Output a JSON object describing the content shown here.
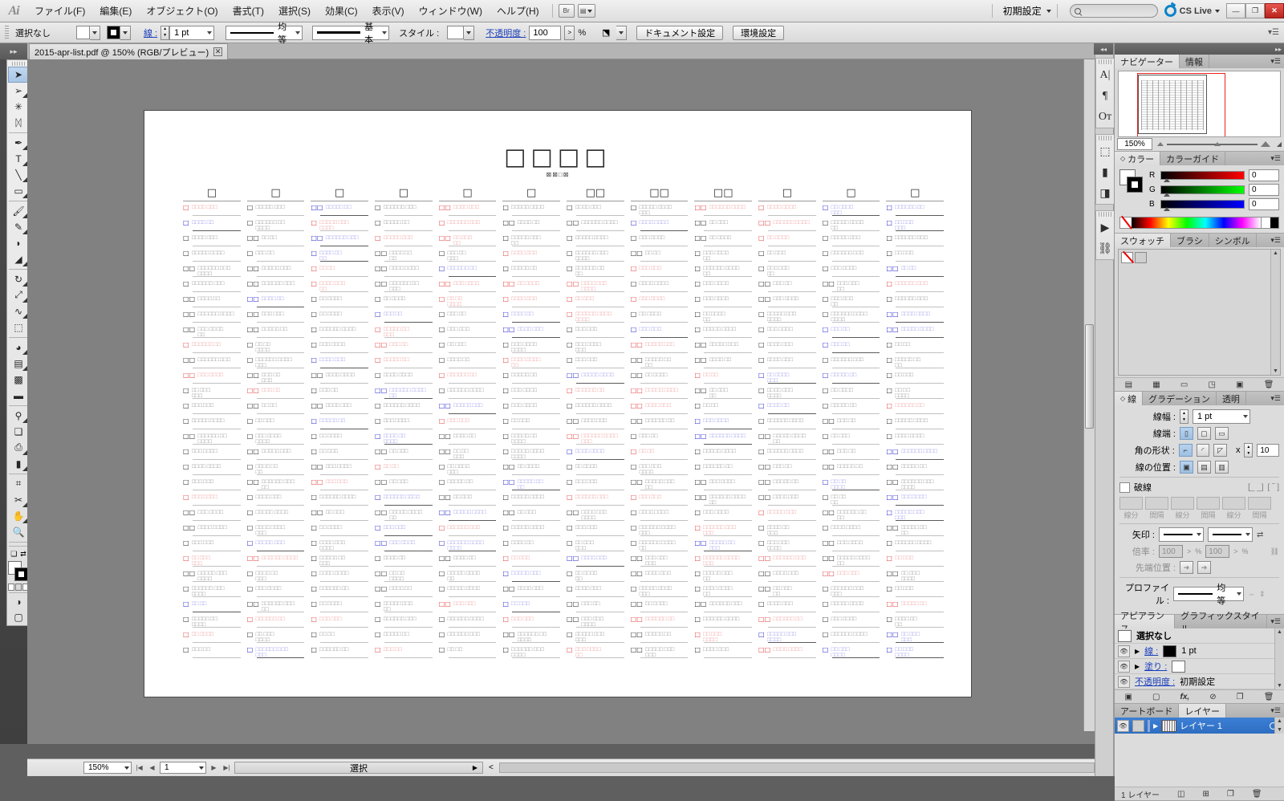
{
  "app": {
    "name": "Adobe Illustrator",
    "logo": "Ai"
  },
  "menubar": {
    "items": [
      {
        "label": "ファイル(F)"
      },
      {
        "label": "編集(E)"
      },
      {
        "label": "オブジェクト(O)"
      },
      {
        "label": "書式(T)"
      },
      {
        "label": "選択(S)"
      },
      {
        "label": "効果(C)"
      },
      {
        "label": "表示(V)"
      },
      {
        "label": "ウィンドウ(W)"
      },
      {
        "label": "ヘルプ(H)"
      }
    ],
    "bridge_button": "Br",
    "arrange_button": "▤",
    "workspace": "初期設定",
    "search_placeholder": "",
    "cs_live": "CS Live",
    "window_buttons": {
      "minimize": "—",
      "restore": "❐",
      "close": "✕"
    }
  },
  "controlbar": {
    "selection_status": "選択なし",
    "stroke_label": "線 :",
    "stroke_weight": "1 pt",
    "profile_label": "均等",
    "brush_label": "基本",
    "style_label": "スタイル :",
    "opacity_label": "不透明度 :",
    "opacity_value": "100",
    "percent": "%",
    "document_setup": "ドキュメント設定",
    "preferences": "環境設定"
  },
  "tabbar": {
    "document_tab": "2015-apr-list.pdf @ 150% (RGB/プレビュー)",
    "close_glyph": "✕"
  },
  "toolbar": {
    "tools": [
      {
        "name": "selection-tool",
        "glyph": "➤",
        "selected": true,
        "flyout": false
      },
      {
        "name": "direct-selection-tool",
        "glyph": "➢",
        "selected": false,
        "flyout": true
      },
      {
        "name": "magic-wand-tool",
        "glyph": "✳",
        "selected": false,
        "flyout": false
      },
      {
        "name": "lasso-tool",
        "glyph": "ᛞ",
        "selected": false,
        "flyout": false
      },
      {
        "name": "pen-tool",
        "glyph": "✒",
        "selected": false,
        "flyout": true
      },
      {
        "name": "type-tool",
        "glyph": "T",
        "selected": false,
        "flyout": true
      },
      {
        "name": "line-segment-tool",
        "glyph": "╲",
        "selected": false,
        "flyout": true
      },
      {
        "name": "rectangle-tool",
        "glyph": "▭",
        "selected": false,
        "flyout": true
      },
      {
        "name": "paintbrush-tool",
        "glyph": "🖌",
        "selected": false,
        "flyout": true
      },
      {
        "name": "pencil-tool",
        "glyph": "✎",
        "selected": false,
        "flyout": true
      },
      {
        "name": "blob-brush-tool",
        "glyph": "◗",
        "selected": false,
        "flyout": false
      },
      {
        "name": "eraser-tool",
        "glyph": "◢",
        "selected": false,
        "flyout": true
      },
      {
        "name": "rotate-tool",
        "glyph": "↻",
        "selected": false,
        "flyout": true
      },
      {
        "name": "scale-tool",
        "glyph": "⤢",
        "selected": false,
        "flyout": true
      },
      {
        "name": "width-tool",
        "glyph": "∿",
        "selected": false,
        "flyout": true
      },
      {
        "name": "free-transform-tool",
        "glyph": "⬚",
        "selected": false,
        "flyout": false
      },
      {
        "name": "shape-builder-tool",
        "glyph": "◕",
        "selected": false,
        "flyout": true
      },
      {
        "name": "perspective-grid-tool",
        "glyph": "▤",
        "selected": false,
        "flyout": true
      },
      {
        "name": "mesh-tool",
        "glyph": "▩",
        "selected": false,
        "flyout": false
      },
      {
        "name": "gradient-tool",
        "glyph": "▬",
        "selected": false,
        "flyout": false
      },
      {
        "name": "eyedropper-tool",
        "glyph": "⚲",
        "selected": false,
        "flyout": true
      },
      {
        "name": "blend-tool",
        "glyph": "❏",
        "selected": false,
        "flyout": false
      },
      {
        "name": "symbol-sprayer-tool",
        "glyph": "⎙",
        "selected": false,
        "flyout": true
      },
      {
        "name": "column-graph-tool",
        "glyph": "▮",
        "selected": false,
        "flyout": true
      },
      {
        "name": "artboard-tool",
        "glyph": "⌗",
        "selected": false,
        "flyout": false
      },
      {
        "name": "slice-tool",
        "glyph": "✂",
        "selected": false,
        "flyout": true
      },
      {
        "name": "hand-tool",
        "glyph": "✋",
        "selected": false,
        "flyout": true
      },
      {
        "name": "zoom-tool",
        "glyph": "🔍",
        "selected": false,
        "flyout": false
      }
    ],
    "fill_color": "#ffffff",
    "stroke_color": "#000000",
    "swap_glyph": "⇄",
    "default_glyph": "❏",
    "screen_modes": [
      "color",
      "gradient",
      "none"
    ]
  },
  "document": {
    "title": "□□□□",
    "subtitle": "⊠⊠□⊠",
    "column_headers": [
      "□",
      "□",
      "□",
      "□",
      "□",
      "□",
      "□□",
      "□□",
      "□□",
      "□",
      "□",
      "□"
    ],
    "columns": 12,
    "rows_per_column": 30
  },
  "statusbar": {
    "zoom": "150%",
    "page": "1",
    "status_text": "選択",
    "first_glyph": "|◀",
    "prev_glyph": "◀",
    "next_glyph": "▶",
    "last_glyph": "▶|",
    "expand_glyph": "<"
  },
  "dock_icons": [
    {
      "name": "character-panel-icon",
      "glyph": "A|"
    },
    {
      "name": "paragraph-panel-icon",
      "glyph": "¶"
    },
    {
      "name": "opentype-panel-icon",
      "glyph": "Oᴛ"
    },
    {
      "name": "transform-panel-icon",
      "glyph": "⬚"
    },
    {
      "name": "align-panel-icon",
      "glyph": "▮"
    },
    {
      "name": "pathfinder-panel-icon",
      "glyph": "◨"
    },
    {
      "name": "flash-panel-icon",
      "glyph": "▶"
    },
    {
      "name": "links-panel-icon",
      "glyph": "⛓"
    }
  ],
  "panels": {
    "navigator": {
      "tabs": [
        {
          "label": "ナビゲーター",
          "active": true
        },
        {
          "label": "情報",
          "active": false
        }
      ],
      "zoom": "150%"
    },
    "color": {
      "tabs": [
        {
          "label": "カラー",
          "active": true
        },
        {
          "label": "カラーガイド",
          "active": false
        }
      ],
      "channels": [
        {
          "label": "R",
          "value": "0",
          "color": "#ff0000"
        },
        {
          "label": "G",
          "value": "0",
          "color": "#00ff00"
        },
        {
          "label": "B",
          "value": "0",
          "color": "#0000ff"
        }
      ]
    },
    "swatches": {
      "tabs": [
        {
          "label": "スウォッチ",
          "active": true
        },
        {
          "label": "ブラシ",
          "active": false
        },
        {
          "label": "シンボル",
          "active": false
        }
      ],
      "footer_icons": [
        "swatch-libraries-icon",
        "show-swatch-kinds-icon",
        "swatch-options-icon",
        "new-group-icon",
        "new-swatch-icon",
        "delete-swatch-icon"
      ]
    },
    "stroke": {
      "tabs": [
        {
          "label": "線",
          "active": true
        },
        {
          "label": "グラデーション",
          "active": false
        },
        {
          "label": "透明",
          "active": false
        }
      ],
      "weight_label": "線幅 :",
      "weight_value": "1 pt",
      "cap_label": "線端 :",
      "corner_label": "角の形状 :",
      "miter_label": "x",
      "miter_value": "10",
      "align_label": "線の位置 :",
      "dash_label": "破線",
      "dash_fields": [
        "",
        "",
        "",
        "",
        "",
        ""
      ],
      "dash_subs": [
        "線分",
        "間隔",
        "線分",
        "間隔",
        "線分",
        "間隔"
      ],
      "arrow_label": "矢印 :",
      "scale_label": "倍率 :",
      "scale_a": "100",
      "scale_b": "100",
      "tip_label": "先端位置 :",
      "profile_label": "プロファイル :",
      "profile_value": "均等"
    },
    "appearance": {
      "tabs": [
        {
          "label": "アピアランス",
          "active": true
        },
        {
          "label": "グラフィックスタイル",
          "active": false
        }
      ],
      "target": "選択なし",
      "rows": [
        {
          "label": "線 :",
          "value": "1 pt",
          "swatch": "#000000"
        },
        {
          "label": "塗り :",
          "value": "",
          "swatch": "#ffffff"
        },
        {
          "label": "不透明度 :",
          "value": "初期設定",
          "swatch": null
        }
      ],
      "footer_icons": [
        "add-new-stroke-icon",
        "add-new-fill-icon",
        "add-new-effect-icon",
        "clear-appearance-icon",
        "duplicate-item-icon",
        "delete-item-icon"
      ]
    },
    "layers": {
      "tabs": [
        {
          "label": "アートボード",
          "active": false
        },
        {
          "label": "レイヤー",
          "active": true
        }
      ],
      "rows": [
        {
          "name": "レイヤー 1",
          "visible": true,
          "locked": false
        }
      ],
      "count_label": "1 レイヤー",
      "footer_icons": [
        "make-clipping-mask-icon",
        "create-new-sublayer-icon",
        "create-new-layer-icon",
        "delete-layer-icon"
      ]
    }
  }
}
